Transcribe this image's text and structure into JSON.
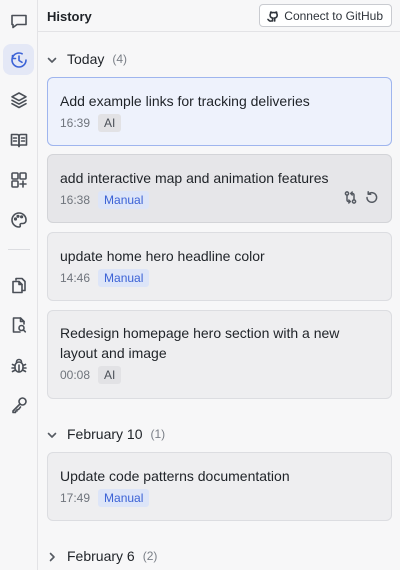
{
  "header": {
    "title": "History",
    "connect_label": "Connect to GitHub"
  },
  "rail": {
    "items": [
      {
        "icon": "chat-icon"
      },
      {
        "icon": "history-icon",
        "active": true
      },
      {
        "icon": "layers-icon"
      },
      {
        "icon": "book-icon"
      },
      {
        "icon": "add-component-icon"
      },
      {
        "icon": "palette-icon"
      },
      {
        "icon": "files-icon"
      },
      {
        "icon": "search-file-icon"
      },
      {
        "icon": "bug-icon"
      },
      {
        "icon": "key-icon"
      }
    ]
  },
  "groups": [
    {
      "title": "Today",
      "count": "(4)",
      "expanded": true,
      "entries": [
        {
          "title": "Add example links for tracking deliveries",
          "time": "16:39",
          "badge": "AI"
        },
        {
          "title": "add interactive map and animation features",
          "time": "16:38",
          "badge": "Manual"
        },
        {
          "title": "update home hero headline color",
          "time": "14:46",
          "badge": "Manual"
        },
        {
          "title": "Redesign homepage hero section with a new layout and image",
          "time": "00:08",
          "badge": "AI"
        }
      ]
    },
    {
      "title": "February 10",
      "count": "(1)",
      "expanded": true,
      "entries": [
        {
          "title": "Update code patterns documentation",
          "time": "17:49",
          "badge": "Manual"
        }
      ]
    },
    {
      "title": "February 6",
      "count": "(2)",
      "expanded": false
    }
  ],
  "colors": {
    "accent": "#3b62d6",
    "selected_bg": "#eef2fc",
    "selected_border": "#9fb5ee"
  }
}
